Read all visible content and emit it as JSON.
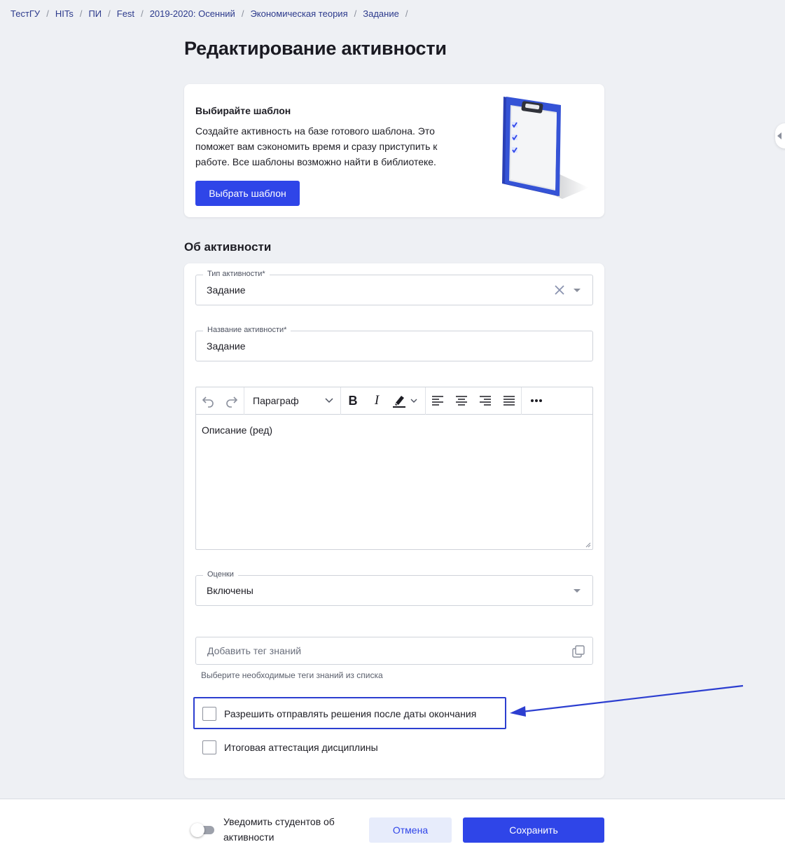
{
  "breadcrumb": [
    "ТестГУ",
    "HITs",
    "ПИ",
    "Fest",
    "2019-2020: Осенний",
    "Экономическая теория",
    "Задание"
  ],
  "breadcrumb_sep": "/",
  "page_title": "Редактирование активности",
  "template": {
    "heading": "Выбирайте шаблон",
    "text": "Создайте активность на базе готового шаблона. Это поможет вам сэкономить время и сразу приступить к работе. Все шаблоны возможно найти в библиотеке.",
    "button": "Выбрать шаблон"
  },
  "section_title": "Об активности",
  "fields": {
    "type": {
      "label": "Тип активности*",
      "value": "Задание"
    },
    "name": {
      "label": "Название активности*",
      "value": "Задание"
    },
    "grades": {
      "label": "Оценки",
      "value": "Включены"
    }
  },
  "editor": {
    "block_format": "Параграф",
    "content": "Описание (ред)"
  },
  "tags": {
    "placeholder": "Добавить тег знаний",
    "hint": "Выберите необходимые теги знаний из списка"
  },
  "checkboxes": {
    "late_submission": "Разрешить отправлять решения после даты окончания",
    "final_attestation": "Итоговая аттестация дисциплины"
  },
  "footer": {
    "notify_label": "Уведомить студентов об активности",
    "notify_enabled": false,
    "cancel": "Отмена",
    "save": "Сохранить"
  },
  "colors": {
    "accent": "#2f45e8",
    "annotation": "#2c3ed0",
    "background": "#eef0f4"
  }
}
